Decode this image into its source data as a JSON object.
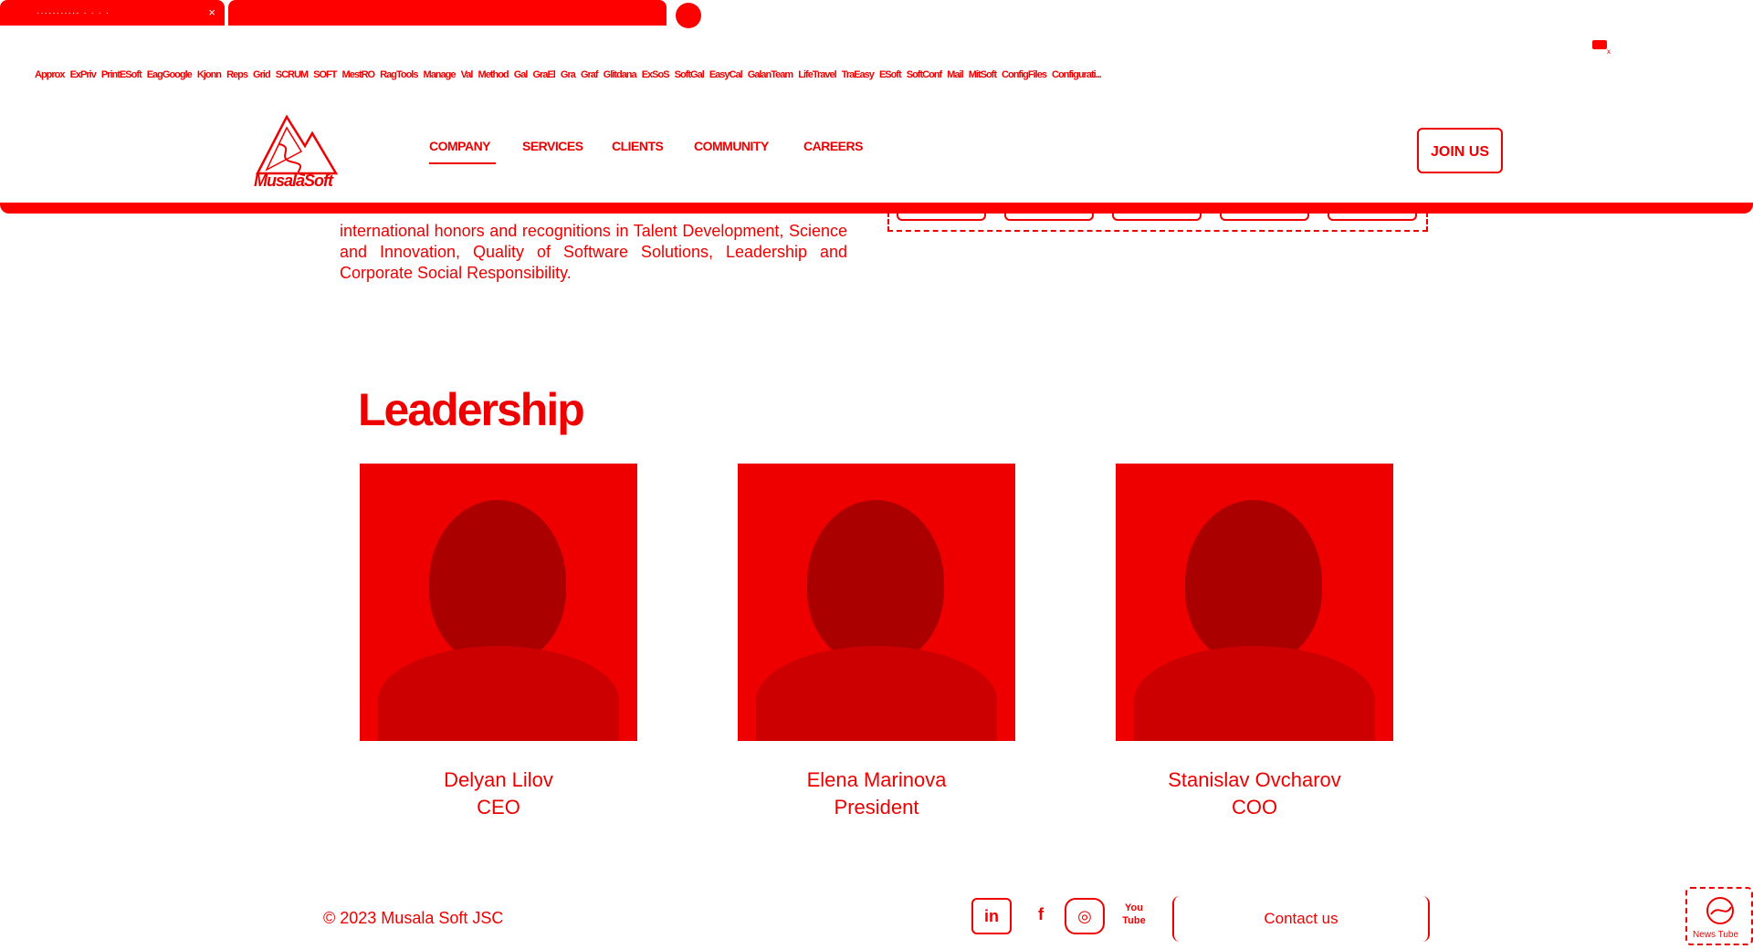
{
  "browser": {
    "tabs": [
      {
        "title": "··········· · · · ·",
        "close": "×"
      },
      {
        "title": ""
      }
    ],
    "bookmarks": [
      "Approx",
      "ExPriv",
      "PrintESoft",
      "EagGoogle",
      "Kjonn",
      "Reps",
      "Grid",
      "SCRUM",
      "SOFT",
      "MestRO",
      "RagTools",
      "Manage",
      "Val",
      "Method",
      "Gal",
      "GraEl",
      "Gra",
      "Graf",
      "Glitdana",
      "ExSoS",
      "SoftGal",
      "EasyCal",
      "GalanTeam",
      "LifeTravel",
      "TraEasy",
      "ESoft",
      "SoftConf",
      "Mail",
      "MitSoft",
      "ConfigFiles",
      "Configurati..."
    ]
  },
  "header": {
    "logo_text": "MusalaSoft",
    "nav": [
      "COMPANY",
      "SERVICES",
      "CLIENTS",
      "COMMUNITY",
      "CAREERS"
    ],
    "join_label": "JOIN US"
  },
  "about": {
    "text": "international honors and recognitions in Talent Development, Science and Innovation, Quality of Software Solutions, Leadership and Corporate Social Responsibility."
  },
  "leadership": {
    "title": "Leadership",
    "people": [
      {
        "name": "Delyan Lilov",
        "role": "CEO"
      },
      {
        "name": "Elena Marinova",
        "role": "President"
      },
      {
        "name": "Stanislav Ovcharov",
        "role": "COO"
      }
    ]
  },
  "footer": {
    "copyright": "© 2023 Musala Soft JSC",
    "social": [
      "in",
      "f",
      "◎",
      "You Tube"
    ],
    "contact_label": "Contact us",
    "widget_label": "News Tube"
  },
  "colors": {
    "accent": "#ff0000"
  }
}
